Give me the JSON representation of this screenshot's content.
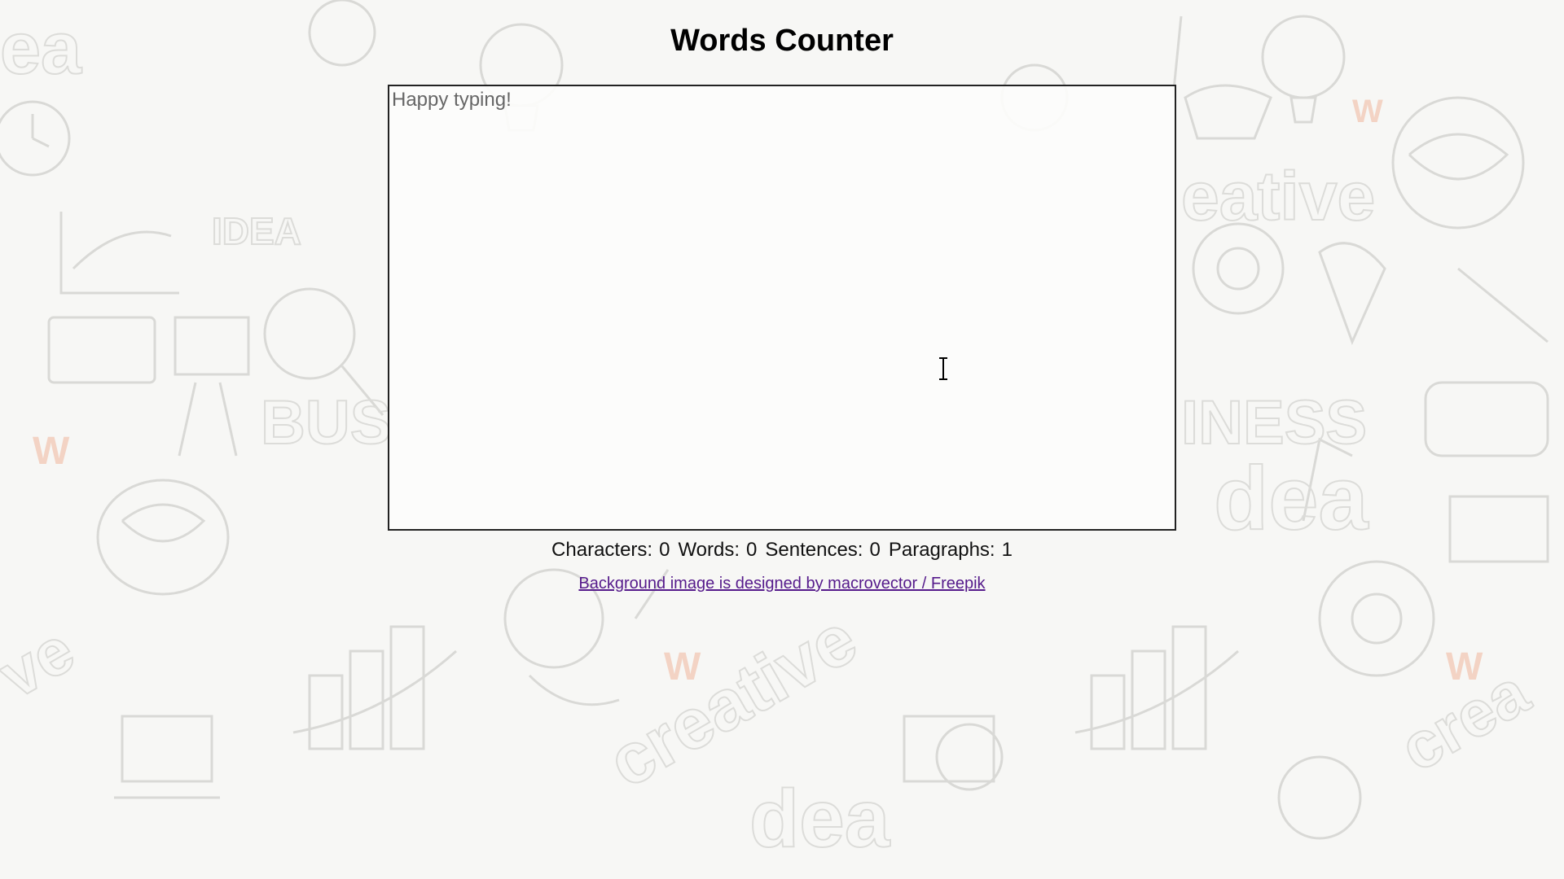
{
  "page": {
    "title": "Words Counter"
  },
  "editor": {
    "placeholder": "Happy typing!",
    "value": ""
  },
  "stats": {
    "characters_label": "Characters:",
    "characters_value": "0",
    "words_label": "Words:",
    "words_value": "0",
    "sentences_label": "Sentences:",
    "sentences_value": "0",
    "paragraphs_label": "Paragraphs:",
    "paragraphs_value": "1"
  },
  "credit": {
    "text": "Background image is designed by macrovector / Freepik"
  },
  "background": {
    "words": [
      "creative",
      "IDEA",
      "BUSINESS",
      "idea",
      "creative",
      "W"
    ],
    "accent_color": "#f2c4b0",
    "doodle_color": "#d8d8d6"
  },
  "icons": {
    "cursor": "text-cursor-icon"
  }
}
